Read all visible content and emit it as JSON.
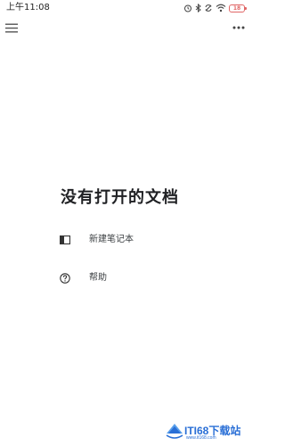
{
  "status_bar": {
    "time": "上午11:08",
    "battery_level": "18",
    "battery_color": "#e06666",
    "icons": [
      "alarm-icon",
      "bluetooth-icon",
      "data-sync-icon",
      "wifi-icon",
      "battery-icon"
    ]
  },
  "app_bar": {
    "menu_icon": "hamburger-menu-icon",
    "more_icon": "more-horizontal-icon"
  },
  "empty_state": {
    "title": "没有打开的文档",
    "actions": [
      {
        "label": "新建笔记本",
        "icon": "notebook-icon"
      },
      {
        "label": "帮助",
        "icon": "help-circle-icon"
      }
    ]
  },
  "watermark": {
    "text": "ITI68下载站",
    "subtext": "www.it168.com"
  },
  "colors": {
    "background": "#ffffff",
    "text": "#202124",
    "watermark": "#2a6fd6"
  }
}
